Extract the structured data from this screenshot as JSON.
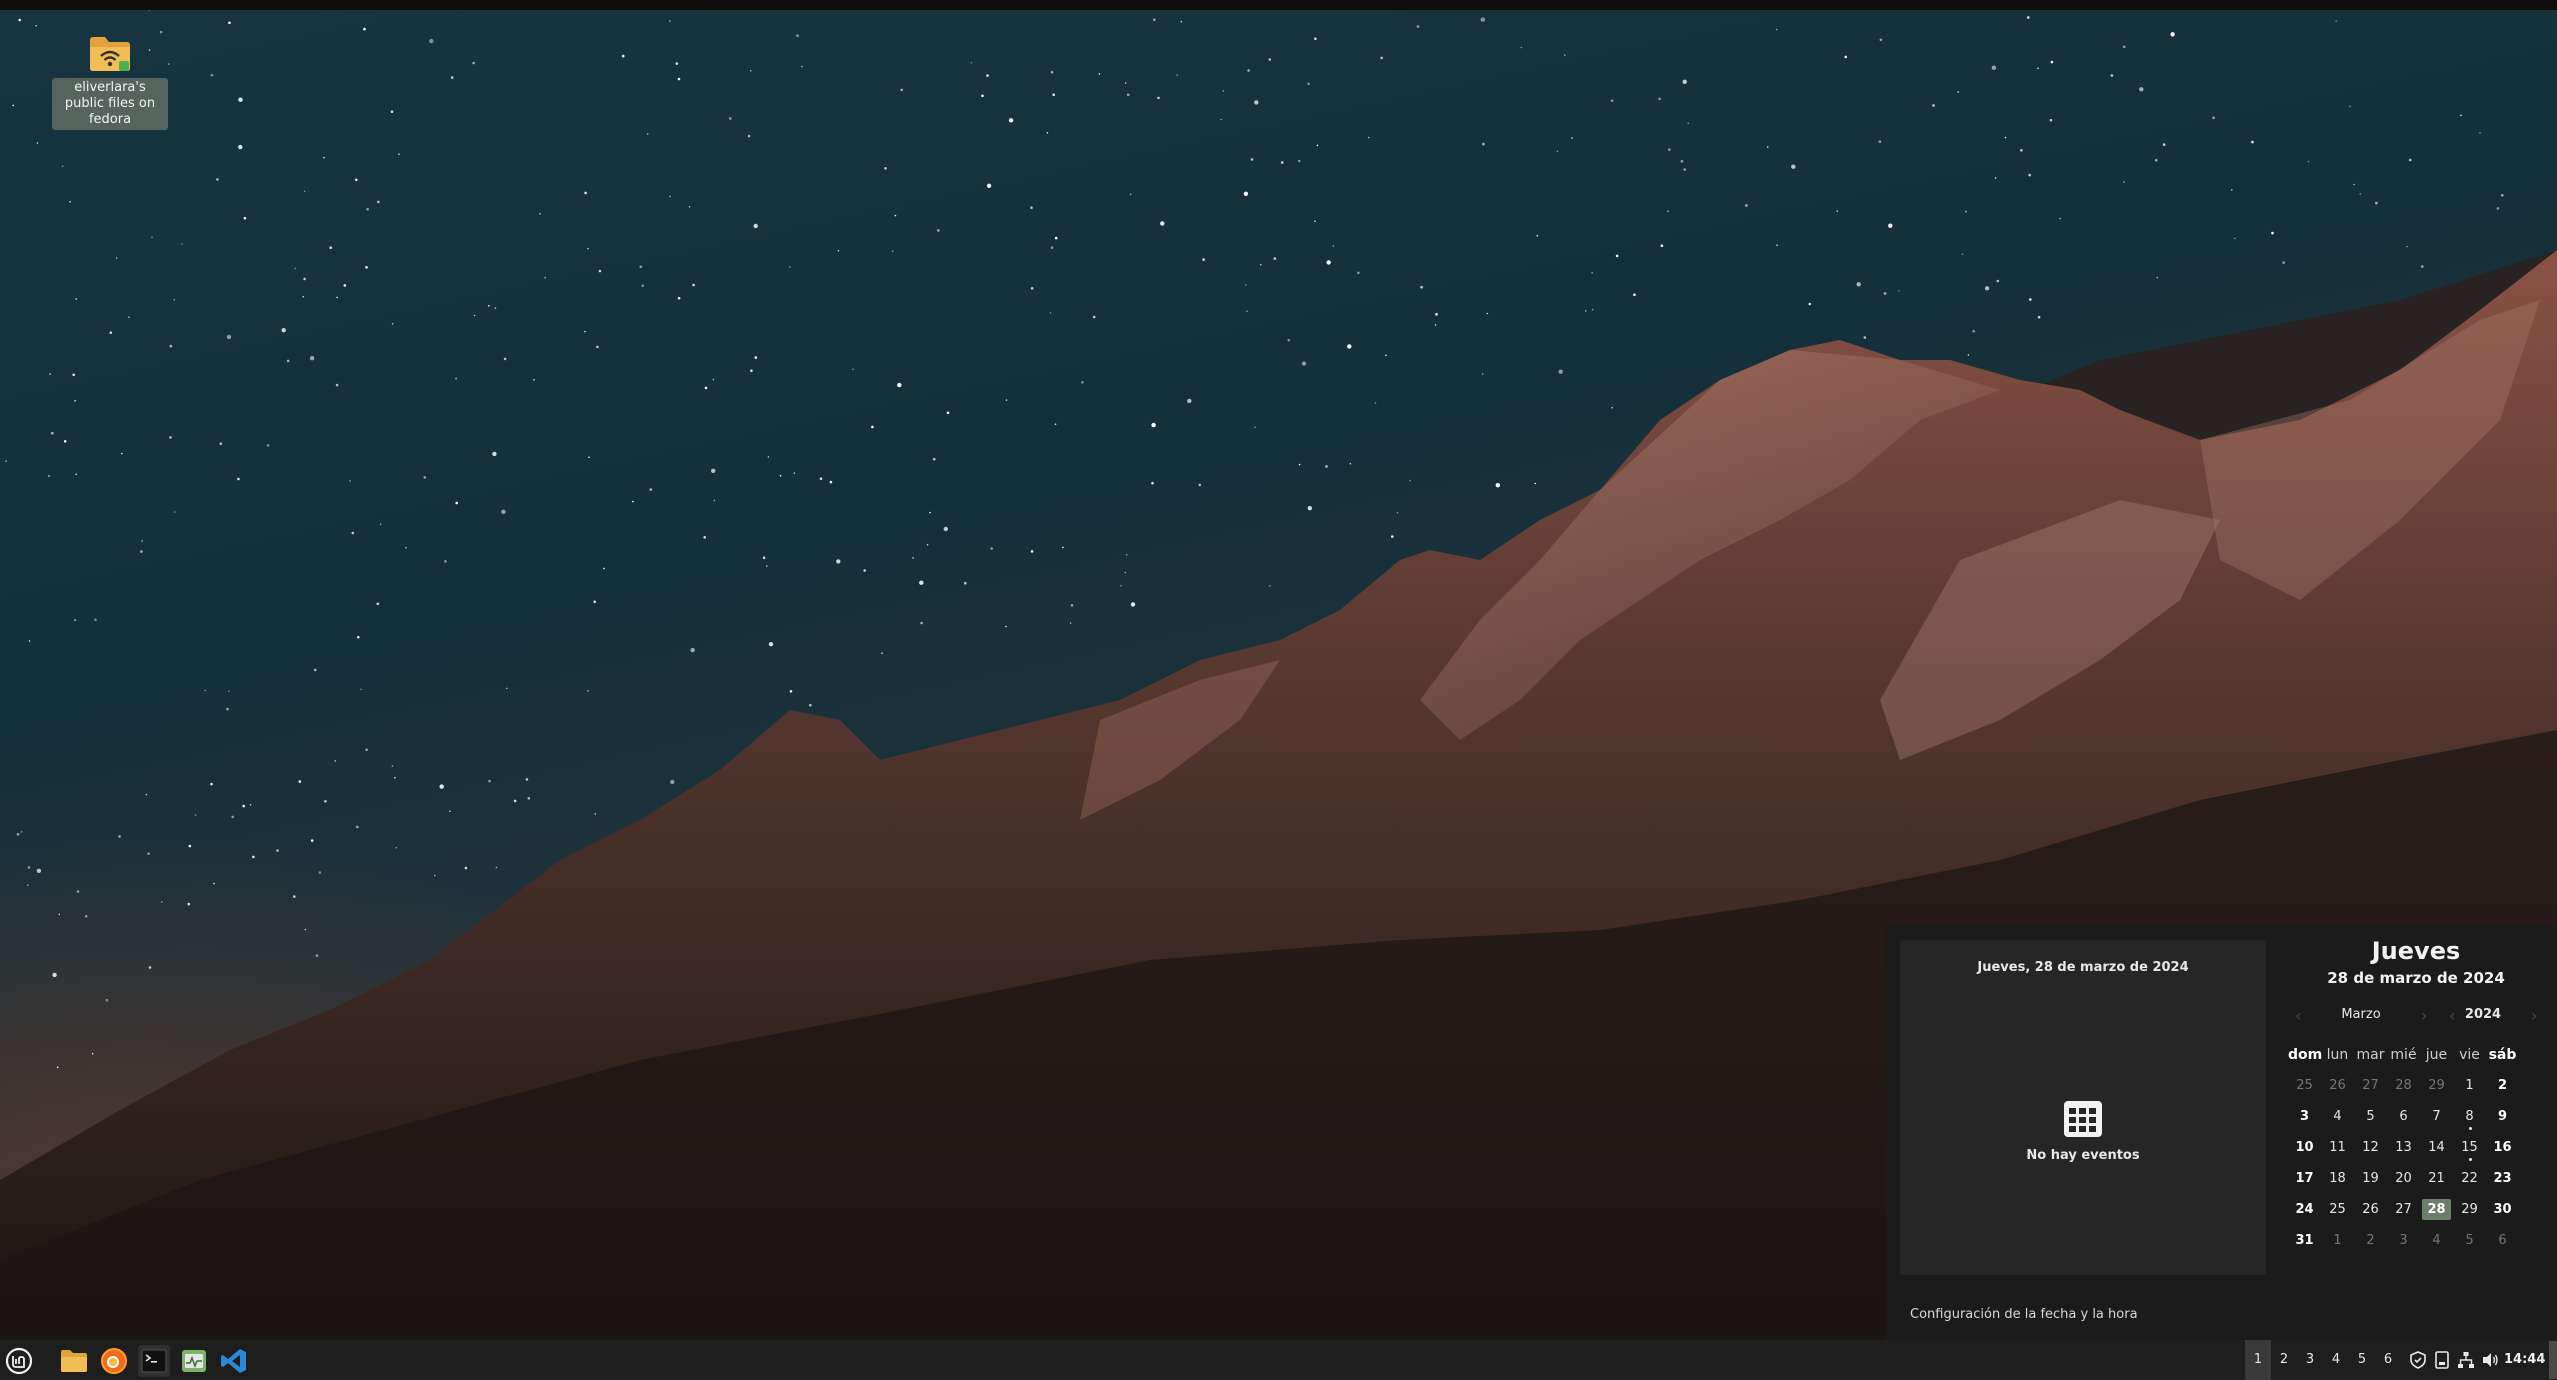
{
  "desktop": {
    "icon_label": "eliverlara's public files on fedora"
  },
  "calendar": {
    "events_header": "Jueves, 28 de marzo de 2024",
    "no_events": "No hay eventos",
    "settings_link": "Configuración de la fecha y la hora",
    "day_name": "Jueves",
    "full_date": "28 de marzo de 2024",
    "month": "Marzo",
    "year": "2024",
    "weekdays": [
      "dom",
      "lun",
      "mar",
      "mié",
      "jue",
      "vie",
      "sáb"
    ],
    "days": [
      [
        "25",
        "26",
        "27",
        "28",
        "29",
        "1",
        "2"
      ],
      [
        "3",
        "4",
        "5",
        "6",
        "7",
        "8",
        "9"
      ],
      [
        "10",
        "11",
        "12",
        "13",
        "14",
        "15",
        "16"
      ],
      [
        "17",
        "18",
        "19",
        "20",
        "21",
        "22",
        "23"
      ],
      [
        "24",
        "25",
        "26",
        "27",
        "28",
        "29",
        "30"
      ],
      [
        "31",
        "1",
        "2",
        "3",
        "4",
        "5",
        "6"
      ]
    ],
    "today": "28",
    "event_marked_days": [
      "8",
      "15"
    ]
  },
  "taskbar": {
    "apps": [
      "menu-icon",
      "files-icon",
      "firefox-icon",
      "terminal-icon",
      "system-monitor-icon",
      "vscode-icon"
    ],
    "workspaces": [
      "1",
      "2",
      "3",
      "4",
      "5",
      "6"
    ],
    "current_workspace": "1",
    "tray": [
      "update-shield-icon",
      "removable-drive-icon",
      "network-icon",
      "volume-icon"
    ],
    "clock": "14:44"
  },
  "colors": {
    "accent": "#6b7e6c",
    "panel": "#1e1e1e",
    "popup": "#1b1b1b"
  }
}
